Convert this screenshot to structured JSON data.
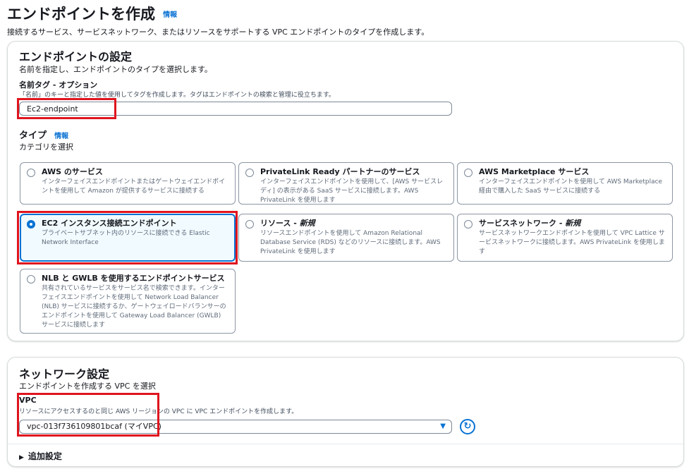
{
  "header": {
    "title": "エンドポイントを作成",
    "info": "情報",
    "description": "接続するサービス、サービスネットワーク、またはリソースをサポートする VPC エンドポイントのタイプを作成します。"
  },
  "endpoint_settings": {
    "title": "エンドポイントの設定",
    "description": "名前を指定し、エンドポイントのタイプを選択します。",
    "name_tag": {
      "label": "名前タグ - オプション",
      "description": "「名前」のキーと指定した値を使用してタグを作成します。タグはエンドポイントの検索と管理に役立ちます。",
      "value": "Ec2-endpoint"
    },
    "type": {
      "label": "タイプ",
      "info": "情報",
      "description": "カテゴリを選択",
      "options": [
        {
          "title": "AWS のサービス",
          "new": "",
          "desc": "インターフェイスエンドポイントまたはゲートウェイエンドポイントを使用して Amazon が提供するサービスに接続する"
        },
        {
          "title": "PrivateLink Ready パートナーのサービス",
          "new": "",
          "desc": "インターフェイスエンドポイントを使用して、[AWS サービスレディ] の表示がある SaaS サービスに接続します。AWS PrivateLink を使用します"
        },
        {
          "title": "AWS Marketplace サービス",
          "new": "",
          "desc": "インターフェイスエンドポイントを使用して AWS Marketplace 経由で購入した SaaS サービスに接続する"
        },
        {
          "title": "EC2 インスタンス接続エンドポイント",
          "new": "",
          "desc": "プライベートサブネット内のリソースに接続できる Elastic Network Interface"
        },
        {
          "title": "リソース - ",
          "new": "新規",
          "desc": "リソースエンドポイントを使用して Amazon Relational Database Service (RDS) などのリソースに接続します。AWS PrivateLink を使用します"
        },
        {
          "title": "サービスネットワーク - ",
          "new": "新規",
          "desc": "サービスネットワークエンドポイントを使用して VPC Lattice サービスネットワークに接続します。AWS PrivateLink を使用します"
        },
        {
          "title": "NLB と GWLB を使用するエンドポイントサービス",
          "new": "",
          "desc": "共有されているサービスをサービス名で検索できます。インターフェイスエンドポイントを使用して Network Load Balancer (NLB) サービスに接続するか、ゲートウェイロードバランサーのエンドポイントを使用して Gateway Load Balancer (GWLB) サービスに接続します"
        }
      ],
      "selected_index": 3
    }
  },
  "network_settings": {
    "title": "ネットワーク設定",
    "description": "エンドポイントを作成する VPC を選択",
    "vpc": {
      "label": "VPC",
      "description": "リソースにアクセスするのと同じ AWS リージョンの VPC に VPC エンドポイントを作成します。",
      "selected": "vpc-013f736109801bcaf (マイVPC)"
    },
    "additional_settings": "追加設定"
  },
  "colors": {
    "accent": "#0972d3",
    "highlight": "#e0141e",
    "selected_bg": "#f1faff"
  }
}
